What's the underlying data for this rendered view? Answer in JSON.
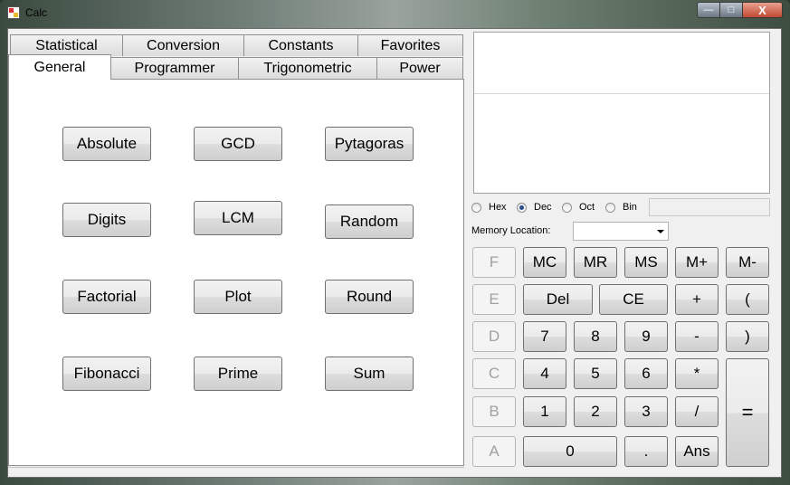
{
  "window": {
    "title": "Calc",
    "minimize_label": "—",
    "maximize_label": "□",
    "close_label": "X"
  },
  "tabs": {
    "row1": [
      "Statistical",
      "Conversion",
      "Constants",
      "Favorites"
    ],
    "row2": [
      "General",
      "Programmer",
      "Trigonometric",
      "Power"
    ],
    "active": "General"
  },
  "general_functions": [
    [
      "Absolute",
      "GCD",
      "Pytagoras"
    ],
    [
      "Digits",
      "LCM",
      "Random"
    ],
    [
      "Factorial",
      "Plot",
      "Round"
    ],
    [
      "Fibonacci",
      "Prime",
      "Sum"
    ]
  ],
  "display": {
    "expression": "",
    "result": ""
  },
  "base_radio": {
    "options": [
      "Hex",
      "Dec",
      "Oct",
      "Bin"
    ],
    "selected": "Dec",
    "converted_value": ""
  },
  "memory": {
    "label": "Memory Location:",
    "selected": ""
  },
  "hex_keys": [
    "F",
    "E",
    "D",
    "C",
    "B",
    "A"
  ],
  "keys": {
    "mc": "MC",
    "mr": "MR",
    "ms": "MS",
    "mplus": "M+",
    "mminus": "M-",
    "del": "Del",
    "ce": "CE",
    "plus": "+",
    "lparen": "(",
    "seven": "7",
    "eight": "8",
    "nine": "9",
    "minus": "-",
    "rparen": ")",
    "four": "4",
    "five": "5",
    "six": "6",
    "times": "*",
    "one": "1",
    "two": "2",
    "three": "3",
    "divide": "/",
    "zero": "0",
    "dot": ".",
    "ans": "Ans",
    "equals": "="
  }
}
